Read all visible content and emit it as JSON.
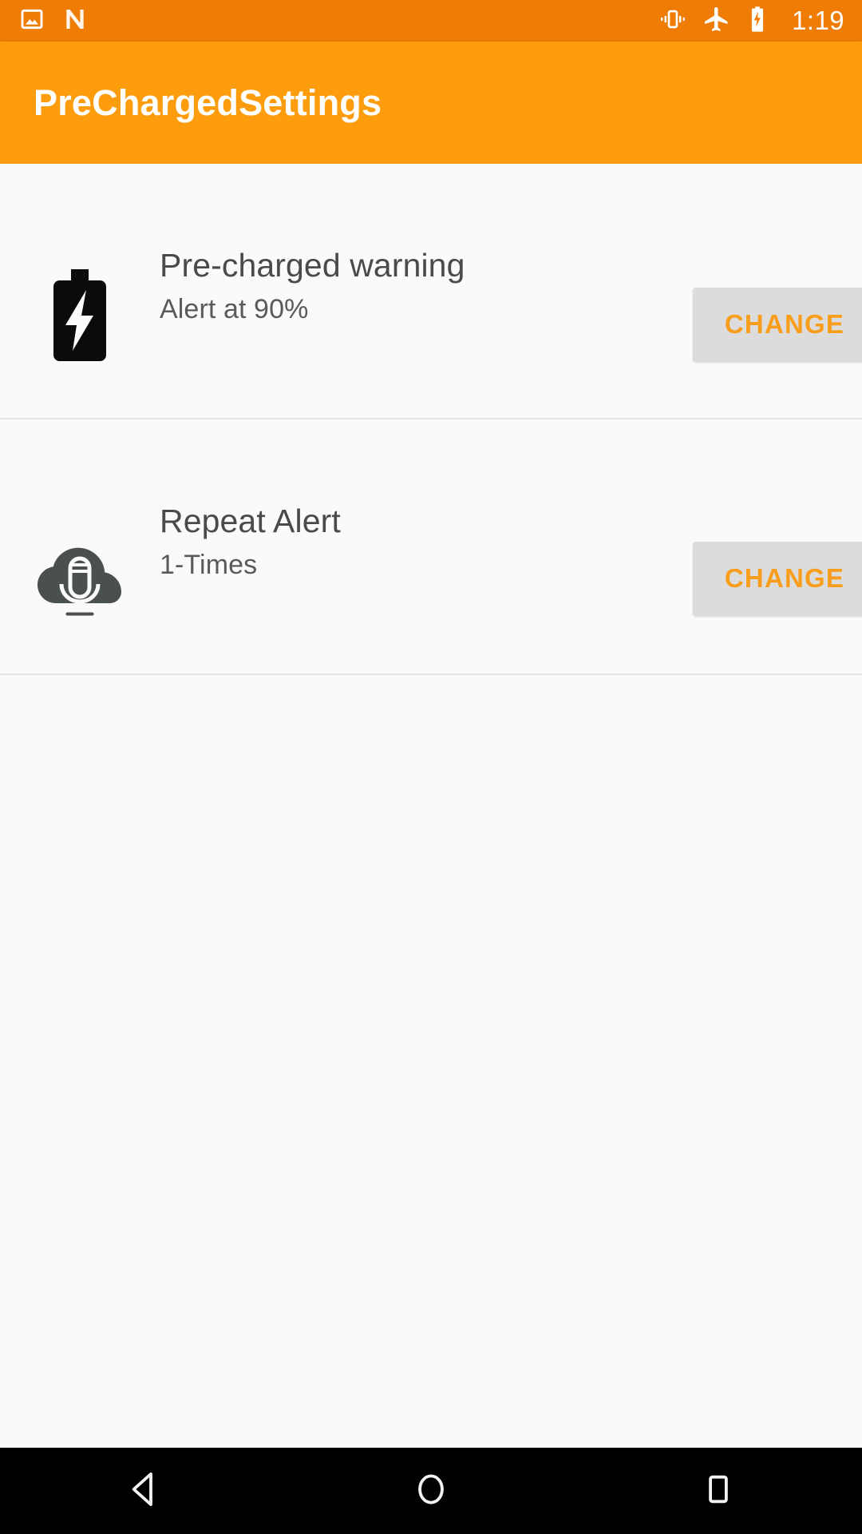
{
  "status_bar": {
    "background_color": "#ef7c05",
    "time": "1:19",
    "left_icons": [
      {
        "name": "photo-icon",
        "label": "Photos"
      },
      {
        "name": "android-n-icon",
        "label": "N"
      }
    ],
    "right_icons": [
      {
        "name": "vibrate-icon",
        "label": "Vibrate"
      },
      {
        "name": "airplane-mode-icon",
        "label": "Airplane mode"
      },
      {
        "name": "battery-charging-icon",
        "label": "Charging"
      }
    ]
  },
  "action_bar": {
    "title": "PreChargedSettings",
    "background_color": "#fd9d0d",
    "title_color": "#ffffff"
  },
  "settings": {
    "accent_color": "#f99d1c",
    "button_background": "#dcdcdc",
    "rows": [
      {
        "icon": "battery-charging-icon",
        "title": "Pre-charged warning",
        "subtitle": "Alert at 90%",
        "button_label": "CHANGE"
      },
      {
        "icon": "cloud-microphone-icon",
        "title": "Repeat Alert",
        "subtitle": "1-Times",
        "button_label": "CHANGE"
      }
    ]
  },
  "nav_bar": {
    "background_color": "#000000",
    "buttons": [
      {
        "name": "back-button",
        "label": "Back"
      },
      {
        "name": "home-button",
        "label": "Home"
      },
      {
        "name": "recents-button",
        "label": "Recents"
      }
    ]
  }
}
